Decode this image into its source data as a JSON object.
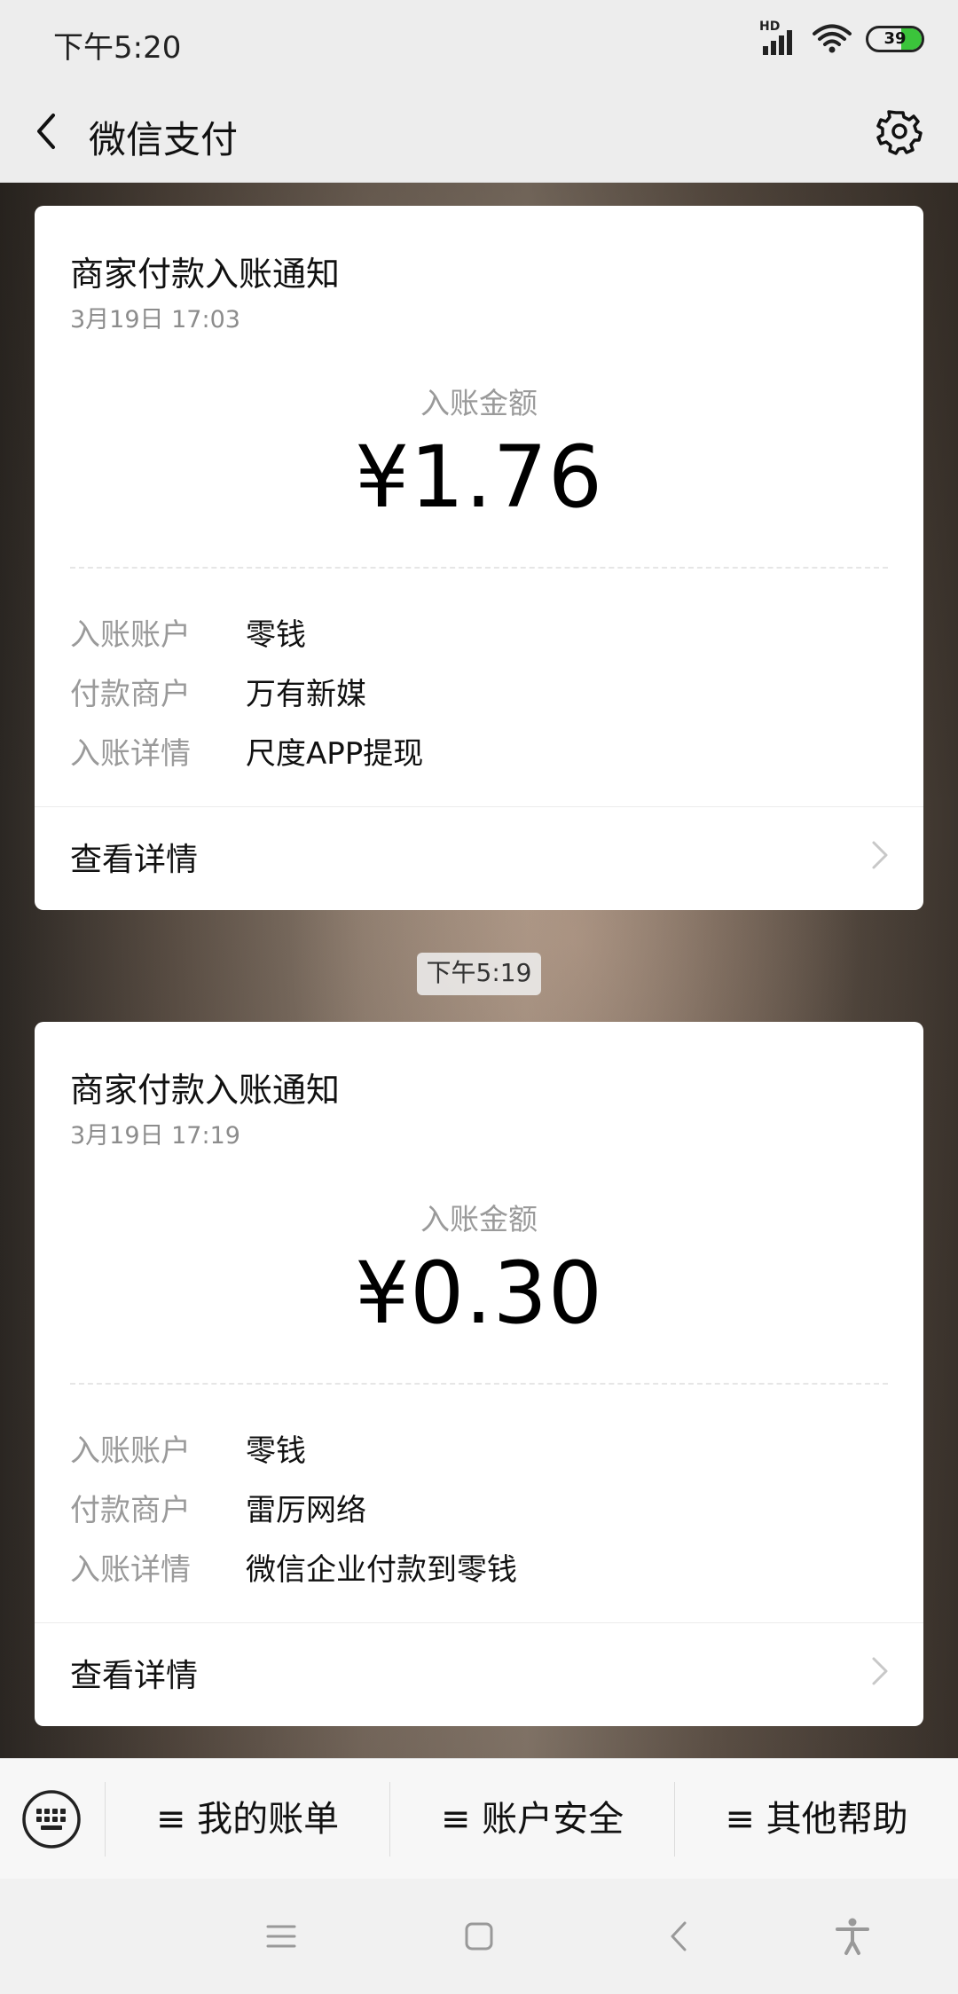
{
  "status_bar": {
    "time": "下午5:20",
    "network": "HD",
    "battery": "39",
    "battery_level_percent": 39,
    "battery_fill_color": "#3bc43b"
  },
  "header": {
    "title": "微信支付",
    "back_icon": "back-arrow-icon",
    "settings_icon": "gear-icon"
  },
  "messages": [
    {
      "title": "商家付款入账通知",
      "date": "3月19日 17:03",
      "amount_label": "入账金额",
      "amount": "¥1.76",
      "rows": [
        {
          "key": "入账账户",
          "value": "零钱"
        },
        {
          "key": "付款商户",
          "value": "万有新媒"
        },
        {
          "key": "入账详情",
          "value": "尺度APP提现"
        }
      ],
      "details_label": "查看详情"
    },
    {
      "title": "商家付款入账通知",
      "date": "3月19日 17:19",
      "amount_label": "入账金额",
      "amount": "¥0.30",
      "rows": [
        {
          "key": "入账账户",
          "value": "零钱"
        },
        {
          "key": "付款商户",
          "value": "雷厉网络"
        },
        {
          "key": "入账详情",
          "value": "微信企业付款到零钱"
        }
      ],
      "details_label": "查看详情"
    }
  ],
  "timestamp": "下午5:19",
  "menu": {
    "keyboard_icon": "keyboard-icon",
    "items": [
      "≡ 我的账单",
      "≡ 账户安全",
      "≡ 其他帮助"
    ]
  },
  "nav": {
    "icons": [
      "menu-icon",
      "home-icon",
      "back-icon",
      "accessibility-icon"
    ]
  }
}
